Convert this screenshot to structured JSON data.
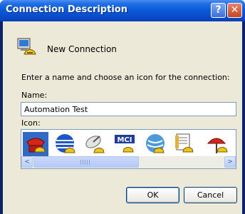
{
  "window": {
    "title": "Connection Description"
  },
  "title_buttons": {
    "help": "?",
    "close": "✕"
  },
  "connection": {
    "name": "New Connection",
    "icon": "phone-connection-icon"
  },
  "prompt": "Enter a name and choose an icon for the connection:",
  "name_label": "Name:",
  "name_value": "Automation Test",
  "icon_label": "Icon:",
  "icons": [
    "red-phone-icon",
    "globe-phone-icon",
    "satellite-phone-icon",
    "mci-phone-icon",
    "att-globe-phone-icon",
    "document-phone-icon",
    "umbrella-phone-icon"
  ],
  "selected_icon": 0,
  "scrollbar": {
    "left": "<",
    "right": ">"
  },
  "buttons": {
    "ok": "OK",
    "cancel": "Cancel"
  }
}
